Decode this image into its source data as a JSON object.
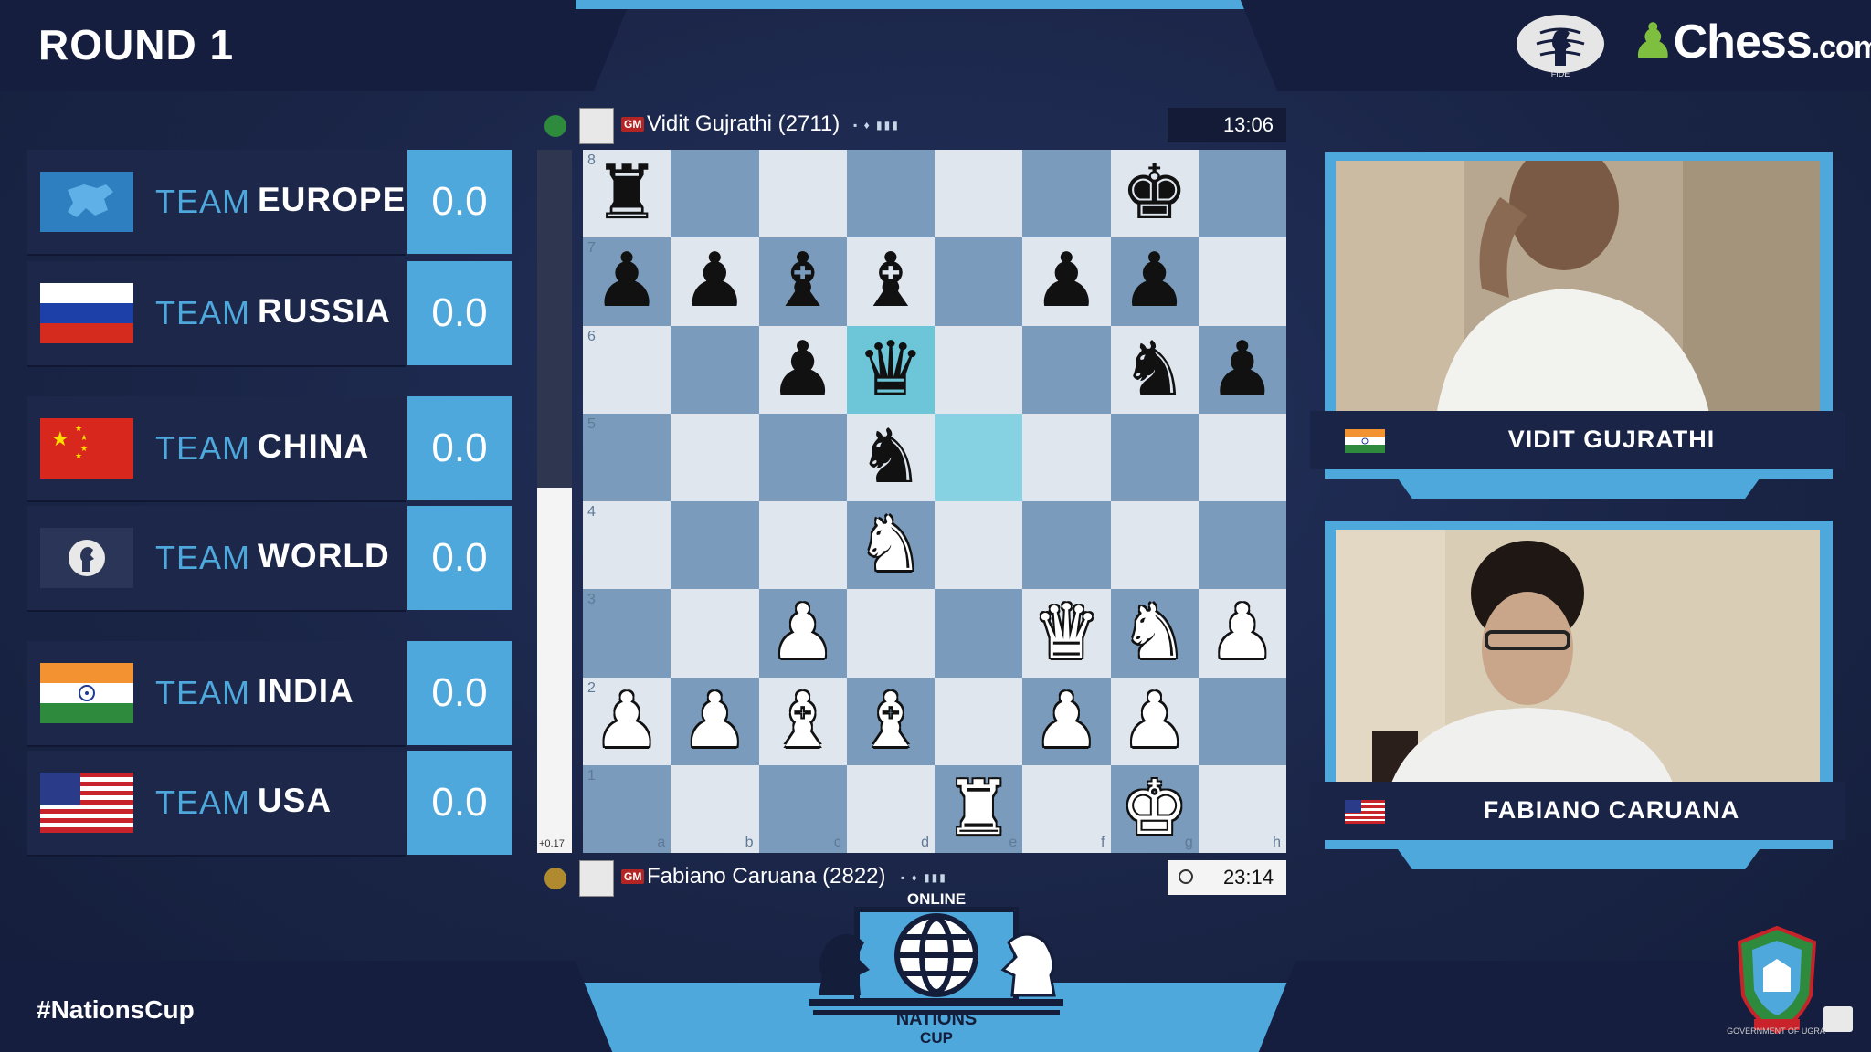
{
  "header": {
    "round_title": "ROUND 1",
    "fide_label": "FIDE",
    "chesscom_main": "Chess",
    "chesscom_suffix": ".com"
  },
  "standings": [
    {
      "prefix": "TEAM",
      "name": "EUROPE",
      "score": "0.0"
    },
    {
      "prefix": "TEAM",
      "name": "RUSSIA",
      "score": "0.0"
    },
    {
      "prefix": "TEAM",
      "name": "CHINA",
      "score": "0.0"
    },
    {
      "prefix": "TEAM",
      "name": "WORLD",
      "score": "0.0"
    },
    {
      "prefix": "TEAM",
      "name": "INDIA",
      "score": "0.0"
    },
    {
      "prefix": "TEAM",
      "name": "USA",
      "score": "0.0"
    }
  ],
  "eval": {
    "value": "+0.17",
    "white_fraction": 0.52
  },
  "players": {
    "top": {
      "title": "GM",
      "name": "Vidit Gujrathi (2711)",
      "clock": "13:06"
    },
    "bottom": {
      "title": "GM",
      "name": "Fabiano Caruana (2822)",
      "clock": "23:14"
    }
  },
  "board": {
    "files": [
      "a",
      "b",
      "c",
      "d",
      "e",
      "f",
      "g",
      "h"
    ],
    "ranks": [
      "8",
      "7",
      "6",
      "5",
      "4",
      "3",
      "2",
      "1"
    ],
    "position": [
      [
        "bR",
        "",
        "",
        "",
        "",
        "",
        "bK",
        ""
      ],
      [
        "bP",
        "bP",
        "bB",
        "bB",
        "",
        "bP",
        "bP",
        ""
      ],
      [
        "",
        "",
        "bP",
        "bQ",
        "",
        "",
        "bN",
        "bP"
      ],
      [
        "",
        "",
        "",
        "bN",
        "",
        "",
        "",
        ""
      ],
      [
        "",
        "",
        "",
        "wN",
        "",
        "",
        "",
        ""
      ],
      [
        "",
        "",
        "wP",
        "",
        "",
        "wQ",
        "wN",
        "wP"
      ],
      [
        "wP",
        "wP",
        "wB",
        "wB",
        "",
        "wP",
        "wP",
        ""
      ],
      [
        "",
        "",
        "",
        "",
        "wR",
        "",
        "wK",
        ""
      ]
    ],
    "highlighted_squares": [
      "d6",
      "e5"
    ]
  },
  "cameras": [
    {
      "name": "VIDIT GUJRATHI",
      "flag": "india"
    },
    {
      "name": "FABIANO CARUANA",
      "flag": "usa"
    }
  ],
  "footer": {
    "hashtag": "#NationsCup",
    "logo_online": "ONLINE",
    "logo_nations": "NATIONS",
    "logo_cup": "CUP",
    "gov_label": "GOVERNMENT OF UGRA"
  },
  "colors": {
    "accent_blue": "#4ea8dc",
    "panel_navy": "#1c2749",
    "board_light": "#dfe6ee",
    "board_dark": "#7a9bbb",
    "highlight": "#6cc6d8"
  }
}
